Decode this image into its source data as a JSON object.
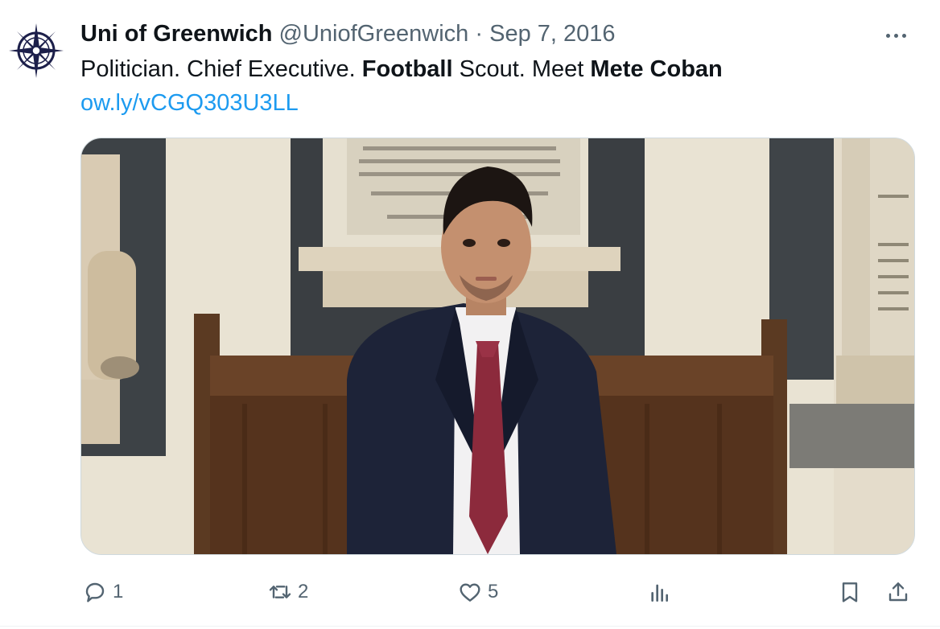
{
  "tweet": {
    "author_name": "Uni of Greenwich",
    "author_handle": "@UniofGreenwich",
    "separator": "·",
    "date": "Sep 7, 2016",
    "text_parts": [
      "Politician. Chief Executive. ",
      "Football",
      " Scout. Meet ",
      "Mete Coban"
    ],
    "link": "ow.ly/vCGQ303U3LL"
  },
  "actions": {
    "reply_count": "1",
    "retweet_count": "2",
    "like_count": "5"
  },
  "colors": {
    "link": "#1d9bf0",
    "secondary": "#536471",
    "navy": "#1c1f4a"
  },
  "icons": [
    "compass-logo-icon",
    "more-icon",
    "reply-icon",
    "retweet-icon",
    "like-icon",
    "views-icon",
    "bookmark-icon",
    "share-icon"
  ]
}
